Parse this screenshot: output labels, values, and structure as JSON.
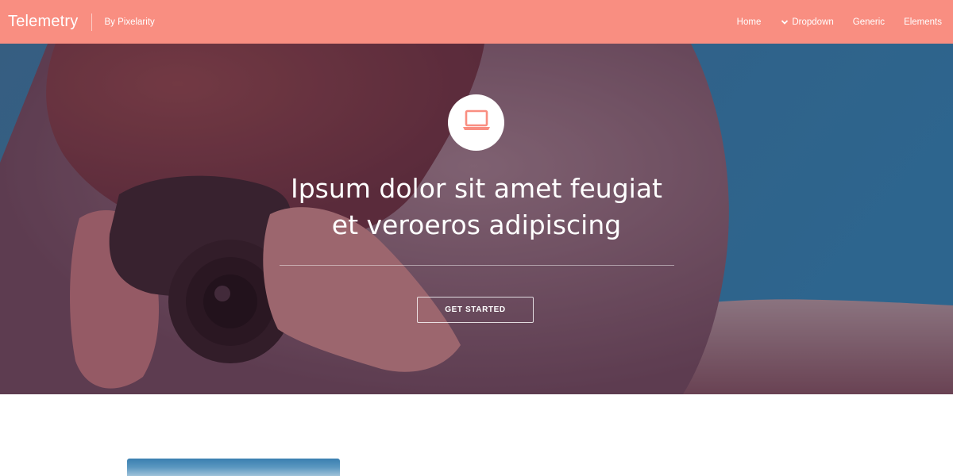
{
  "header": {
    "title": "Telemetry",
    "byline": "By Pixelarity",
    "nav": [
      {
        "label": "Home"
      },
      {
        "label": "Dropdown",
        "icon": "chevron-down-icon"
      },
      {
        "label": "Generic"
      },
      {
        "label": "Elements"
      }
    ]
  },
  "banner": {
    "icon": "laptop-icon",
    "headline_line1": "Ipsum dolor sit amet feugiat",
    "headline_line2": "et veroeros adipiscing",
    "cta_label": "GET STARTED"
  },
  "colors": {
    "header_bg": "#f98e81",
    "accent": "#f98e81",
    "overlay_tint": "#5a2a40",
    "sky": "#1f6fa0",
    "white": "#ffffff"
  }
}
